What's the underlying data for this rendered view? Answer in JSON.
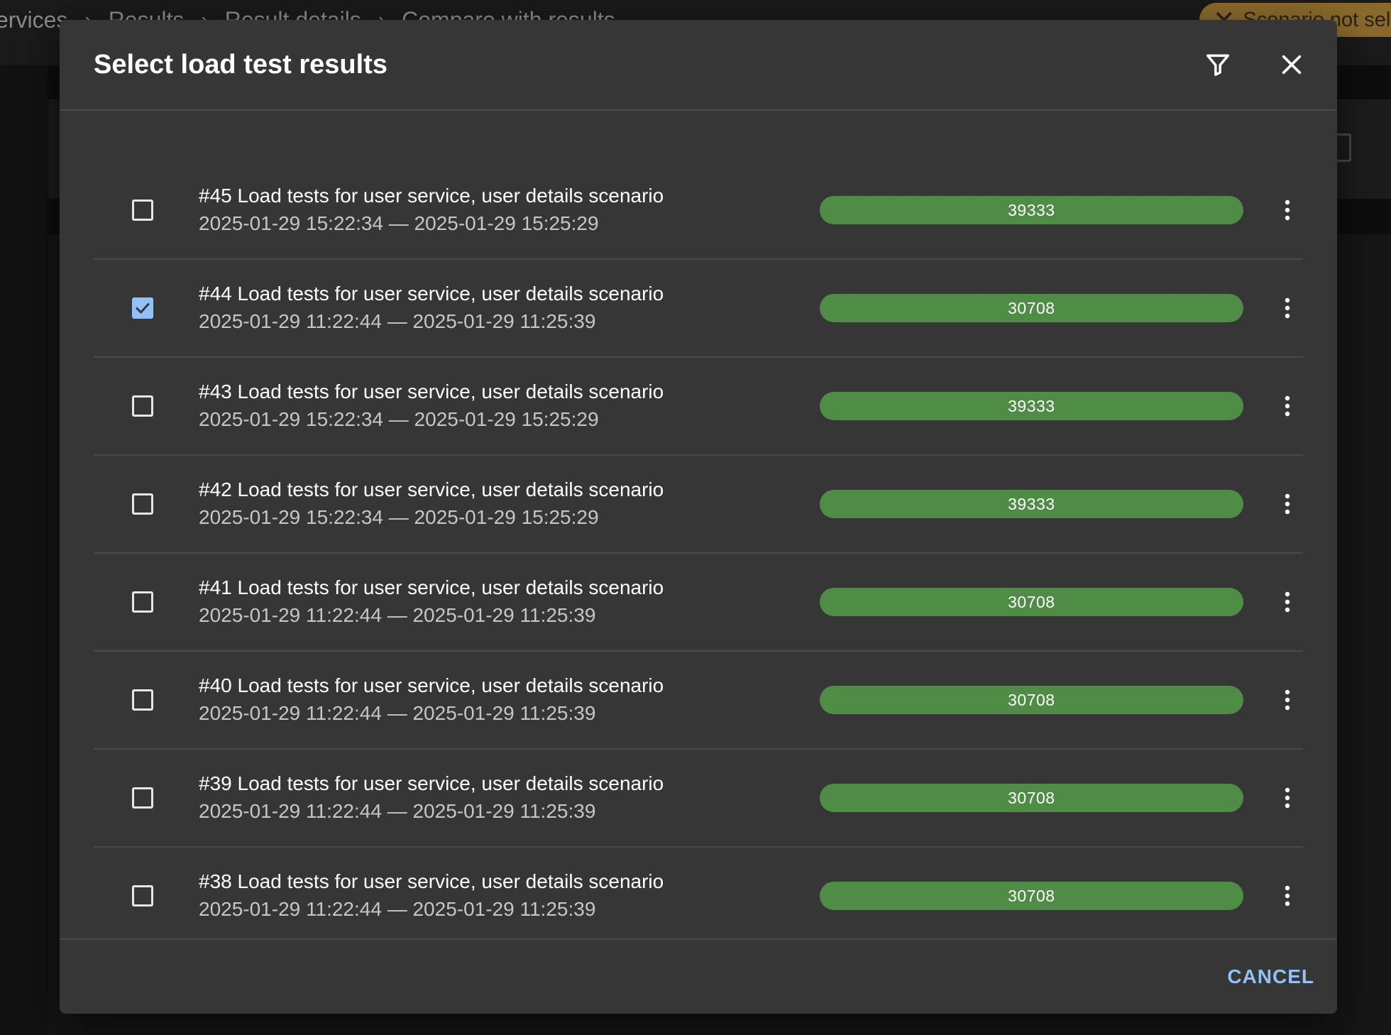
{
  "background": {
    "breadcrumb": [
      "ervices",
      "Results",
      "Result details",
      "Compare with results"
    ],
    "scenario_chip": "Scenario not selec"
  },
  "dialog": {
    "title": "Select load test results",
    "filter_icon": "filter-icon",
    "close_icon": "close-icon",
    "cancel_label": "CANCEL"
  },
  "results": [
    {
      "title": "#45 Load tests for user service, user details scenario",
      "dates": "2025-01-29 15:22:34 — 2025-01-29 15:25:29",
      "value": "39333",
      "checked": false
    },
    {
      "title": "#44 Load tests for user service, user details scenario",
      "dates": "2025-01-29 11:22:44 — 2025-01-29 11:25:39",
      "value": "30708",
      "checked": true
    },
    {
      "title": "#43 Load tests for user service, user details scenario",
      "dates": "2025-01-29 15:22:34 — 2025-01-29 15:25:29",
      "value": "39333",
      "checked": false
    },
    {
      "title": "#42 Load tests for user service, user details scenario",
      "dates": "2025-01-29 15:22:34 — 2025-01-29 15:25:29",
      "value": "39333",
      "checked": false
    },
    {
      "title": "#41 Load tests for user service, user details scenario",
      "dates": "2025-01-29 11:22:44 — 2025-01-29 11:25:39",
      "value": "30708",
      "checked": false
    },
    {
      "title": "#40 Load tests for user service, user details scenario",
      "dates": "2025-01-29 11:22:44 — 2025-01-29 11:25:39",
      "value": "30708",
      "checked": false
    },
    {
      "title": "#39 Load tests for user service, user details scenario",
      "dates": "2025-01-29 11:22:44 — 2025-01-29 11:25:39",
      "value": "30708",
      "checked": false
    },
    {
      "title": "#38 Load tests for user service, user details scenario",
      "dates": "2025-01-29 11:22:44 — 2025-01-29 11:25:39",
      "value": "30708",
      "checked": false
    }
  ],
  "colors": {
    "bar": "#4f8c46",
    "accent": "#90c2f8",
    "dialog_bg": "#363636"
  }
}
